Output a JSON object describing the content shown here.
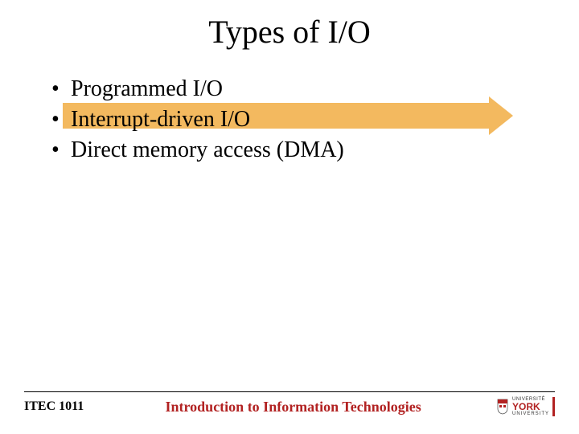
{
  "title": "Types of I/O",
  "bullets": [
    {
      "text": "Programmed I/O"
    },
    {
      "text": "Interrupt-driven I/O"
    },
    {
      "text": "Direct memory access (DMA)"
    }
  ],
  "bullet_char": "•",
  "footer": {
    "course_code": "ITEC 1011",
    "course_title": "Introduction to Information Technologies",
    "logo": {
      "top": "UNIVERSITÉ",
      "main": "YORK",
      "sub": "UNIVERSITY"
    }
  },
  "colors": {
    "highlight": "#f3b95f",
    "accent": "#b22222"
  }
}
